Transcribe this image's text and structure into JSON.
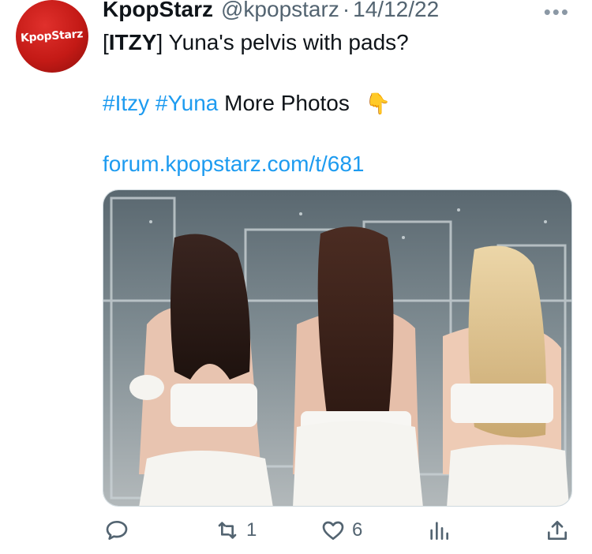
{
  "tweet": {
    "author_name": "KpopStarz",
    "handle": "@kpopstarz",
    "separator": "·",
    "date": "14/12/22",
    "avatar_text": "KpopStarz",
    "text_bracket_open": "[",
    "text_tag": "ITZY",
    "text_bracket_close": "]",
    "text_main": " Yuna's pelvis with pads?",
    "hashtag1": "#Itzy",
    "hashtag2": "#Yuna",
    "more_photos": " More Photos",
    "pointing_emoji": "👇",
    "link": "forum.kpopstarz.com/t/681"
  },
  "actions": {
    "reply_count": "",
    "retweet_count": "1",
    "like_count": "6",
    "views_count": ""
  },
  "icons": {
    "more": "more-icon",
    "reply": "reply-icon",
    "retweet": "retweet-icon",
    "like": "like-icon",
    "views": "views-icon",
    "share": "share-icon"
  },
  "colors": {
    "link": "#1d9bf0",
    "secondary_text": "#536471",
    "avatar_red": "#c41a16"
  }
}
